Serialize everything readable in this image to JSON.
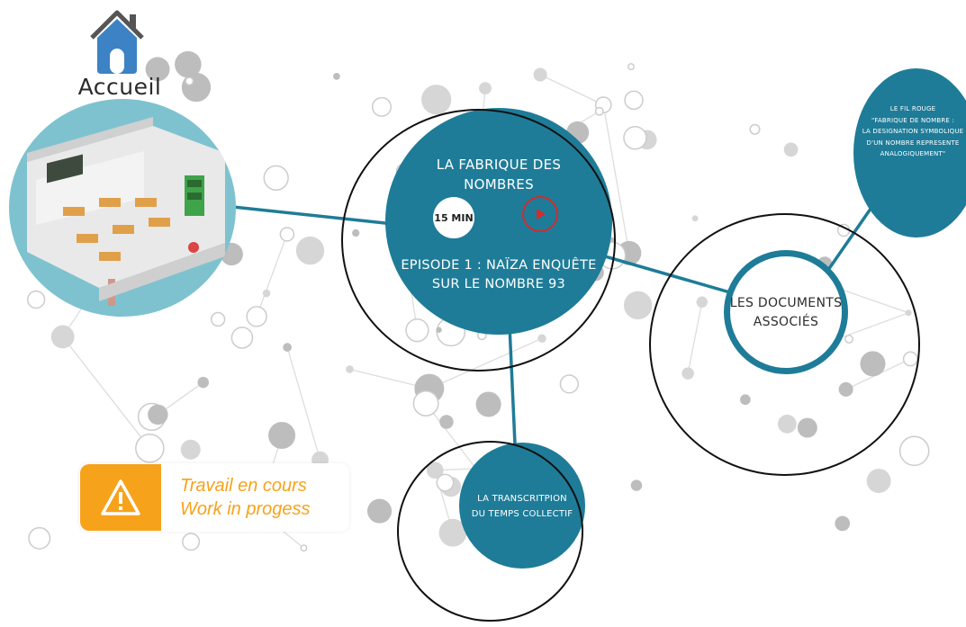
{
  "home": {
    "label": "Accueil",
    "icon": "home-icon"
  },
  "episode": {
    "title_line1": "LA FABRIQUE DES",
    "title_line2": "NOMBRES",
    "duration": "15 MIN",
    "play_icon": "play-icon",
    "subtitle_line1": "EPISODE 1 : NAÏZA ENQUÊTE",
    "subtitle_line2": "SUR LE NOMBRE 93"
  },
  "documents": {
    "line1": "LES DOCUMENTS",
    "line2": "ASSOCIÉS"
  },
  "fil_rouge": {
    "line1": "LE FIL ROUGE",
    "line2": "\"FABRIQUE DE NOMBRE :",
    "line3": "LA DESIGNATION SYMBOLIQUE",
    "line4": "D'UN NOMBRE REPRESENTE",
    "line5": "ANALOGIQUEMENT\""
  },
  "transcription": {
    "line1": "LA TRANSCRITPION",
    "line2": "DU TEMPS COLLECTIF"
  },
  "wip": {
    "line1": "Travail en cours",
    "line2": "Work in progess",
    "icon": "warning-icon"
  },
  "colors": {
    "teal": "#1e7c98",
    "orange": "#f7a21b",
    "play_red": "#d42b2b",
    "node_gray": "#c9c9c9"
  }
}
